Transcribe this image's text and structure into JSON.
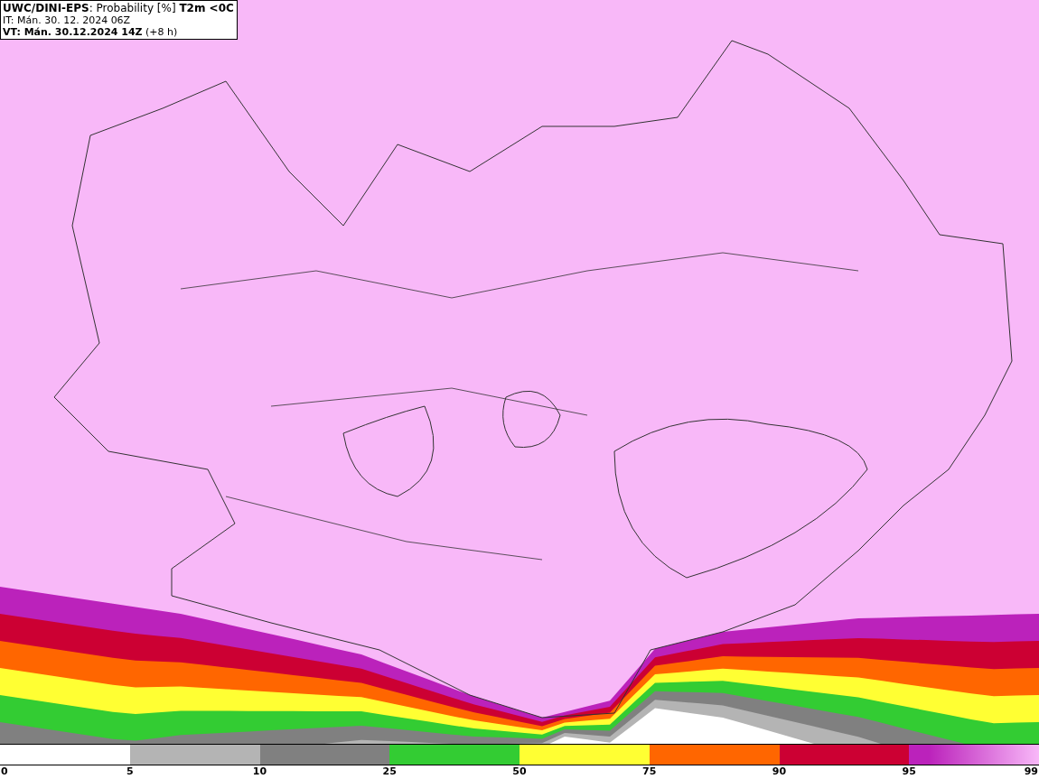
{
  "header": {
    "lines": [
      "**UWC/DINI-EPS**: Probability [%] **T2m <0C**",
      "IT: Mán. 30. 12. 2024 06Z",
      "**VT: Mán. 30.12.2024 14Z** (+8 h)"
    ]
  },
  "legend": {
    "segments": [
      {
        "color": "#ffffff"
      },
      {
        "color": "#b4b4b4"
      },
      {
        "color": "#808080"
      },
      {
        "color": "#33cc33"
      },
      {
        "color": "#ffff33"
      },
      {
        "color": "#ff6600"
      },
      {
        "color": "#cc0033"
      },
      {
        "color": "#bb22bb"
      }
    ],
    "labels": [
      "0",
      "5",
      "10",
      "25",
      "50",
      "75",
      "90",
      "95",
      "99"
    ]
  }
}
